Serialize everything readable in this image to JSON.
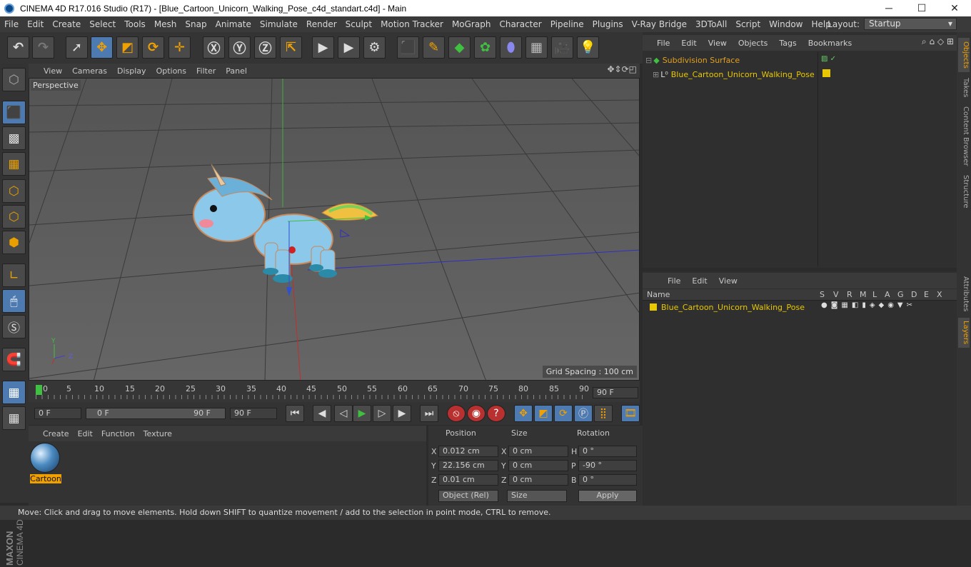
{
  "window": {
    "title": "CINEMA 4D R17.016 Studio (R17) - [Blue_Cartoon_Unicorn_Walking_Pose_c4d_standart.c4d] - Main",
    "minimize": "─",
    "maximize": "☐",
    "close": "✕"
  },
  "menu": [
    "File",
    "Edit",
    "Create",
    "Select",
    "Tools",
    "Mesh",
    "Snap",
    "Animate",
    "Simulate",
    "Render",
    "Sculpt",
    "Motion Tracker",
    "MoGraph",
    "Character",
    "Pipeline",
    "Plugins",
    "V-Ray Bridge",
    "3DToAll",
    "Script",
    "Window",
    "Help"
  ],
  "layout": {
    "label": "Layout:",
    "value": "Startup"
  },
  "viewport": {
    "menu": [
      "View",
      "Cameras",
      "Display",
      "Options",
      "Filter",
      "Panel"
    ],
    "camera_label": "Perspective",
    "grid_spacing": "Grid Spacing : 100 cm",
    "axis_y": "Y",
    "axis_z": "Z"
  },
  "timeline": {
    "ticks": [
      "0",
      "5",
      "10",
      "15",
      "20",
      "25",
      "30",
      "35",
      "40",
      "45",
      "50",
      "55",
      "60",
      "65",
      "70",
      "75",
      "80",
      "85",
      "90"
    ],
    "current_frame": "90 F",
    "start_field": "0 F",
    "range_start": "0 F",
    "range_end": "90 F",
    "end_field": "90 F"
  },
  "materials": {
    "menu": [
      "Create",
      "Edit",
      "Function",
      "Texture"
    ],
    "items": [
      {
        "name": "Cartoon"
      }
    ]
  },
  "coordinates": {
    "headers": {
      "position": "Position",
      "size": "Size",
      "rotation": "Rotation"
    },
    "rows": [
      {
        "axis": "X",
        "position": "0.012 cm",
        "size_axis": "X",
        "size": "0 cm",
        "rot_axis": "H",
        "rotation": "0 °"
      },
      {
        "axis": "Y",
        "position": "22.156 cm",
        "size_axis": "Y",
        "size": "0 cm",
        "rot_axis": "P",
        "rotation": "-90 °"
      },
      {
        "axis": "Z",
        "position": "0.01 cm",
        "size_axis": "Z",
        "size": "0 cm",
        "rot_axis": "B",
        "rotation": "0 °"
      }
    ],
    "mode": "Object (Rel)",
    "size_mode": "Size",
    "apply": "Apply"
  },
  "objects": {
    "menu": [
      "File",
      "Edit",
      "View",
      "Objects",
      "Tags",
      "Bookmarks"
    ],
    "items": [
      {
        "name": "Subdivision Surface",
        "color": "#e0a020"
      },
      {
        "name": "Blue_Cartoon_Unicorn_Walking_Pose",
        "color": "#e8c800"
      }
    ]
  },
  "layers": {
    "menu": [
      "File",
      "Edit",
      "View"
    ],
    "columns": [
      "Name",
      "S",
      "V",
      "R",
      "M",
      "L",
      "A",
      "G",
      "D",
      "E",
      "X"
    ],
    "items": [
      {
        "name": "Blue_Cartoon_Unicorn_Walking_Pose",
        "color": "#e8c800"
      }
    ]
  },
  "side_tabs": [
    "Objects",
    "Takes",
    "Content Browser",
    "Structure",
    "Attributes",
    "Layers"
  ],
  "status": "Move: Click and drag to move elements. Hold down SHIFT to quantize movement / add to the selection in point mode, CTRL to remove.",
  "branding": {
    "maxon": "MAXON",
    "product": "CINEMA 4D"
  }
}
